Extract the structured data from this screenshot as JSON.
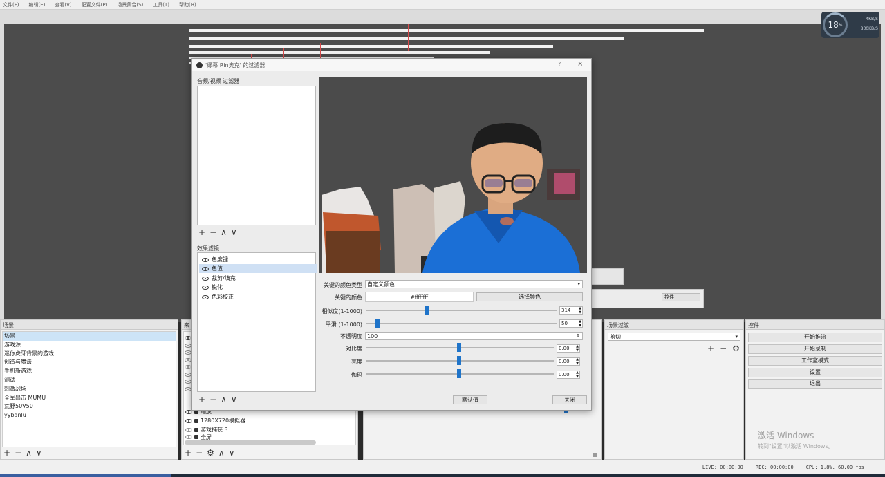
{
  "menu": [
    "文件(F)",
    "编辑(E)",
    "查看(V)",
    "配置文件(P)",
    "场景集合(S)",
    "工具(T)",
    "帮助(H)"
  ],
  "hud": {
    "cpu_percent": "18",
    "cpu_unit": "%",
    "stat_up": "4KB/S",
    "stat_down": "830KB/S"
  },
  "dialog": {
    "title": "'绿幕 Rin奥克' 的过滤器",
    "help": "?",
    "close": "×",
    "audio_video_label": "音频/视频 过滤器",
    "effects_label": "效果滤镜",
    "effect_filters": [
      {
        "name": "色度键",
        "selected": false
      },
      {
        "name": "色值",
        "selected": true
      },
      {
        "name": "裁剪/填充",
        "selected": false
      },
      {
        "name": "锐化",
        "selected": false
      },
      {
        "name": "色彩校正",
        "selected": false
      }
    ],
    "props": {
      "key_color_type_label": "关键的颜色类型",
      "key_color_type_value": "自定义颜色",
      "key_color_label": "关键的颜色",
      "key_color_value": "#ffffffff",
      "select_color_button": "选择颜色",
      "similarity_label": "相似度(1-1000)",
      "similarity_value": "314",
      "similarity_level": 0.314,
      "smoothness_label": "平滑 (1-1000)",
      "smoothness_value": "50",
      "smoothness_level": 0.05,
      "opacity_label": "不透明度",
      "opacity_value": "100",
      "contrast_label": "对比度",
      "contrast_value": "0.00",
      "brightness_label": "亮度",
      "brightness_value": "0.00",
      "gamma_label": "伽玛",
      "gamma_value": "0.00"
    },
    "defaults_button": "默认值",
    "close_button": "关闭"
  },
  "scenes": {
    "title": "场景",
    "items": [
      "场景",
      "游戏源",
      "迷你虎牙背景的游戏",
      "创造与魔法",
      "手机新游戏",
      "测试",
      "刺激战场",
      "全军出击 MUMU",
      "荒野50V50",
      "yybanlu"
    ]
  },
  "sources": {
    "title": "来",
    "items": [
      {
        "name": "缩放",
        "visible": true
      },
      {
        "name": "1280X720模拟器",
        "visible": true
      },
      {
        "name": "游戏捕获 3",
        "visible": false
      },
      {
        "name": "全屏",
        "visible": false
      }
    ]
  },
  "transitions": {
    "title": "场景过渡",
    "value": "剪切",
    "label": "控件"
  },
  "controls": {
    "title": "控件",
    "buttons": [
      "开始推流",
      "开始录制",
      "工作室模式",
      "设置",
      "退出"
    ]
  },
  "status": {
    "live": "LIVE: 00:00:00",
    "rec": "REC: 00:00:00",
    "cpu": "CPU: 1.8%, 60.00 fps"
  },
  "watermark": {
    "line1": "激活 Windows",
    "line2": "转到\"设置\"以激活 Windows。"
  },
  "colors": {
    "accent": "#1f74c9",
    "selection": "#cde4f7",
    "canvas": "#4c4c4c"
  }
}
